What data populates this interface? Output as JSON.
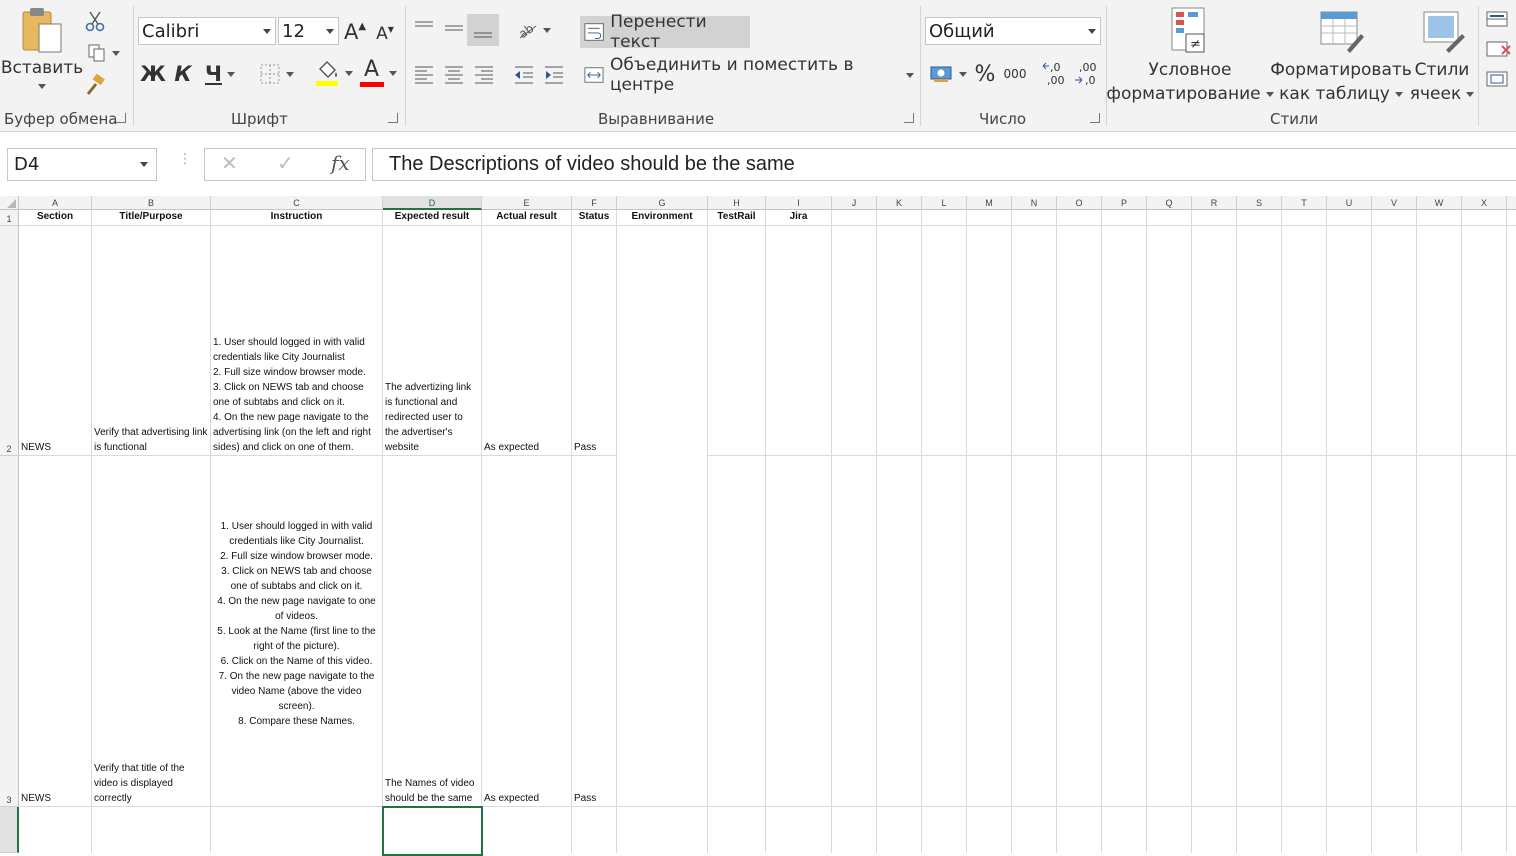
{
  "ribbon": {
    "clipboard": {
      "paste_label": "Вставить",
      "group_label": "Буфер обмена"
    },
    "font": {
      "name": "Calibri",
      "size": "12",
      "bold": "Ж",
      "italic": "К",
      "underline": "Ч",
      "grow": "A",
      "shrink": "A",
      "font_color_letter": "A",
      "group_label": "Шрифт",
      "highlight_color": "#ffff00",
      "font_color": "#ff0000"
    },
    "alignment": {
      "wrap_text": "Перенести текст",
      "merge_center": "Объединить и поместить в центре",
      "group_label": "Выравнивание"
    },
    "number": {
      "format": "Общий",
      "percent": "%",
      "thousands": "000",
      "inc_decimal": "←,0 ,00",
      "dec_decimal": ",00 →,0",
      "group_label": "Число"
    },
    "styles": {
      "conditional_line1": "Условное",
      "conditional_line2": "форматирование",
      "format_table_line1": "Форматировать",
      "format_table_line2": "как таблицу",
      "cell_styles_line1": "Стили",
      "cell_styles_line2": "ячеек",
      "group_label": "Стили"
    }
  },
  "formula_bar": {
    "name_box": "D4",
    "cancel": "✕",
    "enter": "✓",
    "fx": "fx",
    "content": "The Descriptions of video should be the same"
  },
  "sheet": {
    "columns": [
      "A",
      "B",
      "C",
      "D",
      "E",
      "F",
      "G",
      "H",
      "I",
      "J",
      "K",
      "L",
      "M",
      "N",
      "O",
      "P",
      "Q",
      "R",
      "S",
      "T",
      "U",
      "V",
      "W",
      "X"
    ],
    "selected_column": "D",
    "rows": [
      "1",
      "2",
      "3"
    ],
    "header_row": [
      "Section",
      "Title/Purpose",
      "Instruction",
      "Expected result",
      "Actual result",
      "Status",
      "Environment",
      "TestRail",
      "Jira"
    ],
    "row2": {
      "section": "NEWS",
      "title": "Verify that advertising link is functional",
      "instruction": [
        "1. User should logged in with valid credentials like City Journalist",
        "2. Full size window browser mode.",
        "3. Click on NEWS tab and choose one of subtabs and click on it.",
        "4. On the new page navigate to the advertising link (on the left and right sides) and click on one of them."
      ],
      "expected": "The advertizing link is functional and redirected user to the advertiser's website",
      "actual": "As expected",
      "status": "Pass"
    },
    "row3": {
      "section": "NEWS",
      "title": "Verify that title of the video is displayed correctly",
      "instruction": [
        "1. User should logged in with valid credentials like City Journalist.",
        "2. Full size window browser mode.",
        "3. Click on NEWS tab and choose one of subtabs and click on it.",
        "4. On the new page navigate to one of videos.",
        "5. Look at the Name (first line to the right of the picture).",
        "6. Click on the Name of this video.",
        "7. On the new page navigate to the video Name (above the video screen).",
        "8. Compare these Names."
      ],
      "expected": "The Names of video should be the same",
      "actual": "As expected",
      "status": "Pass"
    },
    "selected_cell": "D4"
  },
  "colors": {
    "accent": "#217346",
    "ribbon_bg": "#f3f3f3",
    "wrap_active_bg": "#d2d2d2"
  }
}
